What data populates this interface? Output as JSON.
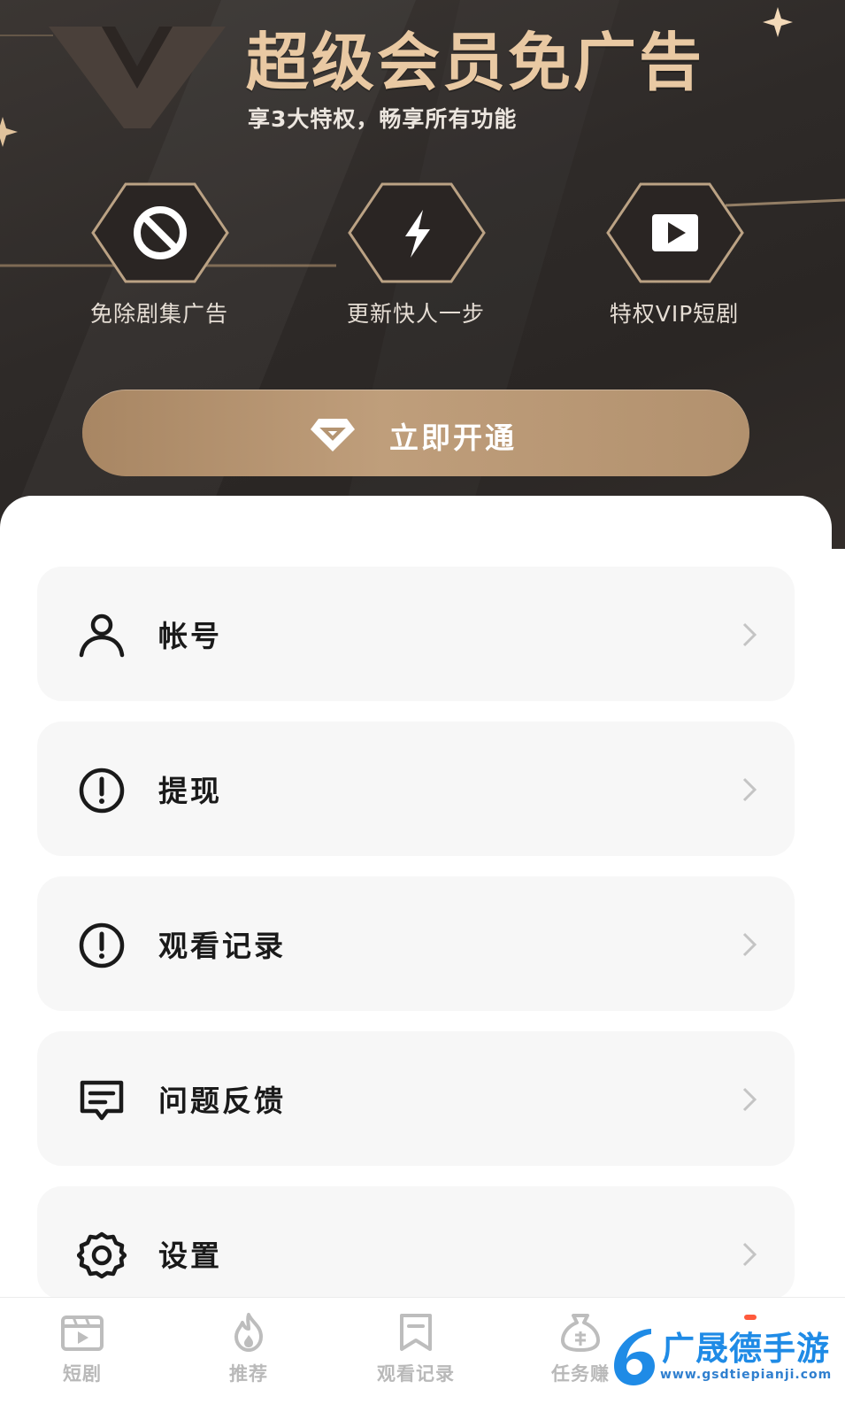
{
  "vip_banner": {
    "title": "超级会员免广告",
    "subtitle": "享3大特权，畅享所有功能",
    "features": [
      {
        "label": "免除剧集广告",
        "icon": "no-ads-icon"
      },
      {
        "label": "更新快人一步",
        "icon": "lightning-icon"
      },
      {
        "label": "特权VIP短剧",
        "icon": "play-icon"
      }
    ],
    "open_button_label": "立即开通",
    "accent_color": "#e9c9a3",
    "button_color": "#b59572"
  },
  "menu": {
    "items": [
      {
        "label": "帐号",
        "icon": "user-icon"
      },
      {
        "label": "提现",
        "icon": "exclamation-circle-icon"
      },
      {
        "label": "观看记录",
        "icon": "exclamation-circle-icon"
      },
      {
        "label": "问题反馈",
        "icon": "message-icon"
      },
      {
        "label": "设置",
        "icon": "gear-icon"
      }
    ]
  },
  "bottom_nav": {
    "items": [
      {
        "label": "短剧",
        "icon": "clapperboard-icon"
      },
      {
        "label": "推荐",
        "icon": "flame-icon"
      },
      {
        "label": "观看记录",
        "icon": "bookmark-icon"
      },
      {
        "label": "任务赚",
        "icon": "money-bag-icon"
      }
    ]
  },
  "watermark": {
    "title": "广晟德手游",
    "url": "www.gsdtiepianji.com"
  }
}
